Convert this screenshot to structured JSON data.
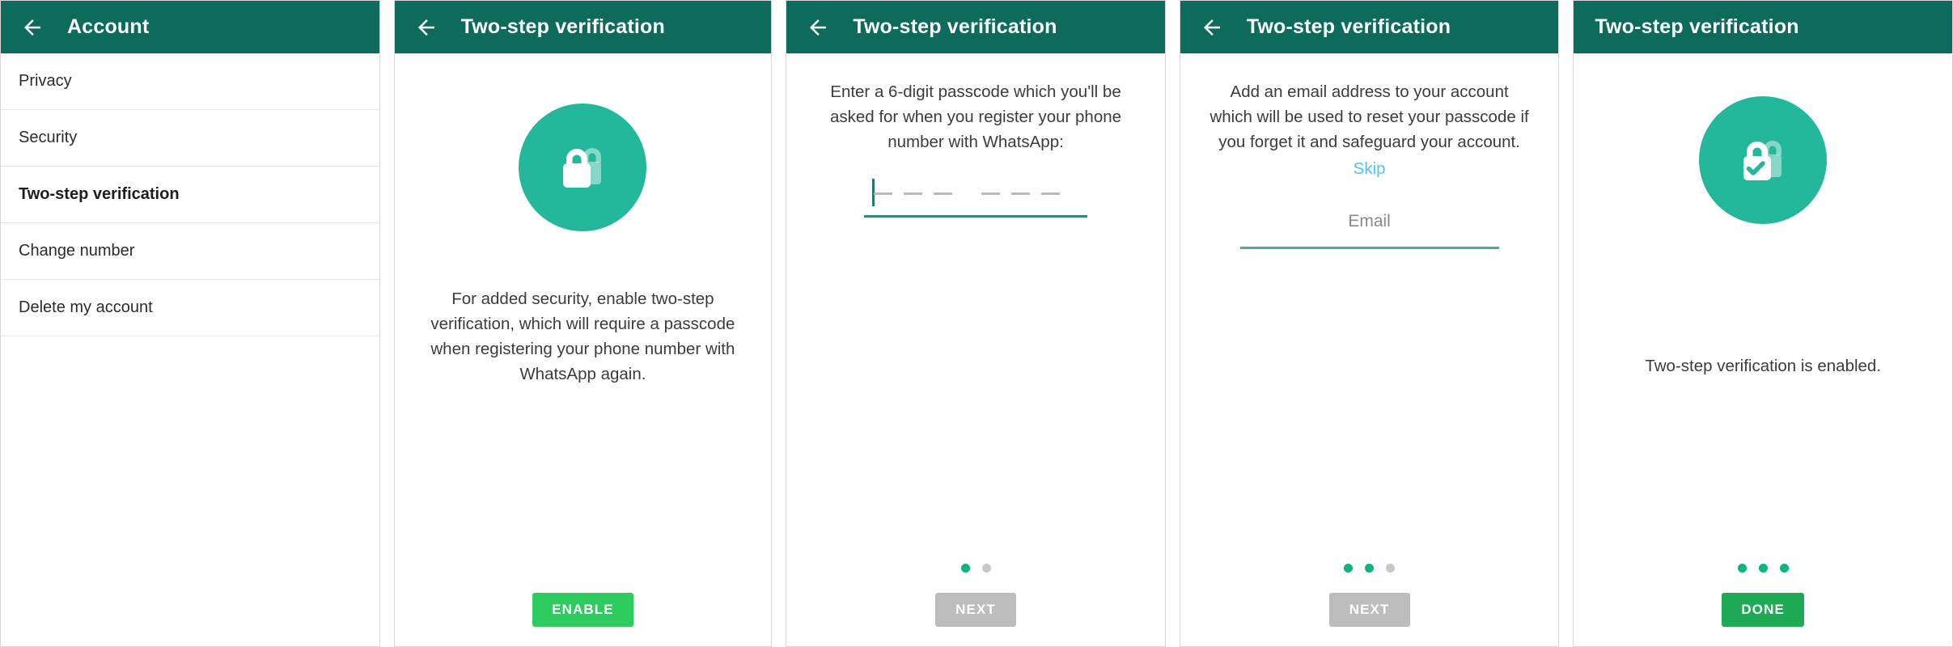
{
  "colors": {
    "appbar": "#0d6b5b",
    "badge": "#23b79b",
    "accent_dot": "#09b57e",
    "enable_button": "#2ecc5f",
    "done_button": "#1faa55",
    "disabled_button": "#bdbdbd",
    "skip_link": "#4fc3f7",
    "field_underline": "#2e8b79"
  },
  "panels": [
    {
      "id": "account-settings",
      "appbar": {
        "title": "Account",
        "back_icon": "back-arrow-icon",
        "has_back": true
      },
      "list": [
        {
          "label": "Privacy",
          "current": false
        },
        {
          "label": "Security",
          "current": false
        },
        {
          "label": "Two-step verification",
          "current": true
        },
        {
          "label": "Change number",
          "current": false
        },
        {
          "label": "Delete my account",
          "current": false
        }
      ]
    },
    {
      "id": "two-step-intro",
      "appbar": {
        "title": "Two-step verification",
        "back_icon": "back-arrow-icon",
        "has_back": true
      },
      "icon": "lock-icon",
      "body_text": "For added security, enable two-step verification, which will require a passcode when registering your phone number with WhatsApp again.",
      "cta": {
        "label": "ENABLE",
        "state": "enabled"
      }
    },
    {
      "id": "passcode-entry",
      "appbar": {
        "title": "Two-step verification",
        "back_icon": "back-arrow-icon",
        "has_back": true
      },
      "top_text": "Enter a 6-digit passcode which you'll be asked for when you register your phone number with WhatsApp:",
      "passcode": {
        "value": "",
        "digit_count": 6,
        "group_break_after": 3,
        "caret_visible": true
      },
      "dots": {
        "total": 2,
        "active": 1
      },
      "cta": {
        "label": "NEXT",
        "state": "disabled"
      }
    },
    {
      "id": "email-entry",
      "appbar": {
        "title": "Two-step verification",
        "back_icon": "back-arrow-icon",
        "has_back": true
      },
      "top_text": "Add an email address to your account which will be used to reset your passcode if you forget it and safeguard your account.",
      "skip_label": "Skip",
      "email_field": {
        "value": "",
        "placeholder": "Email"
      },
      "dots": {
        "total": 3,
        "active": 2
      },
      "cta": {
        "label": "NEXT",
        "state": "disabled"
      }
    },
    {
      "id": "two-step-enabled",
      "appbar": {
        "title": "Two-step verification",
        "back_icon": "",
        "has_back": false
      },
      "icon": "lock-check-icon",
      "body_text": "Two-step verification is enabled.",
      "dots": {
        "total": 3,
        "active": 3
      },
      "cta": {
        "label": "DONE",
        "state": "enabled"
      }
    }
  ]
}
